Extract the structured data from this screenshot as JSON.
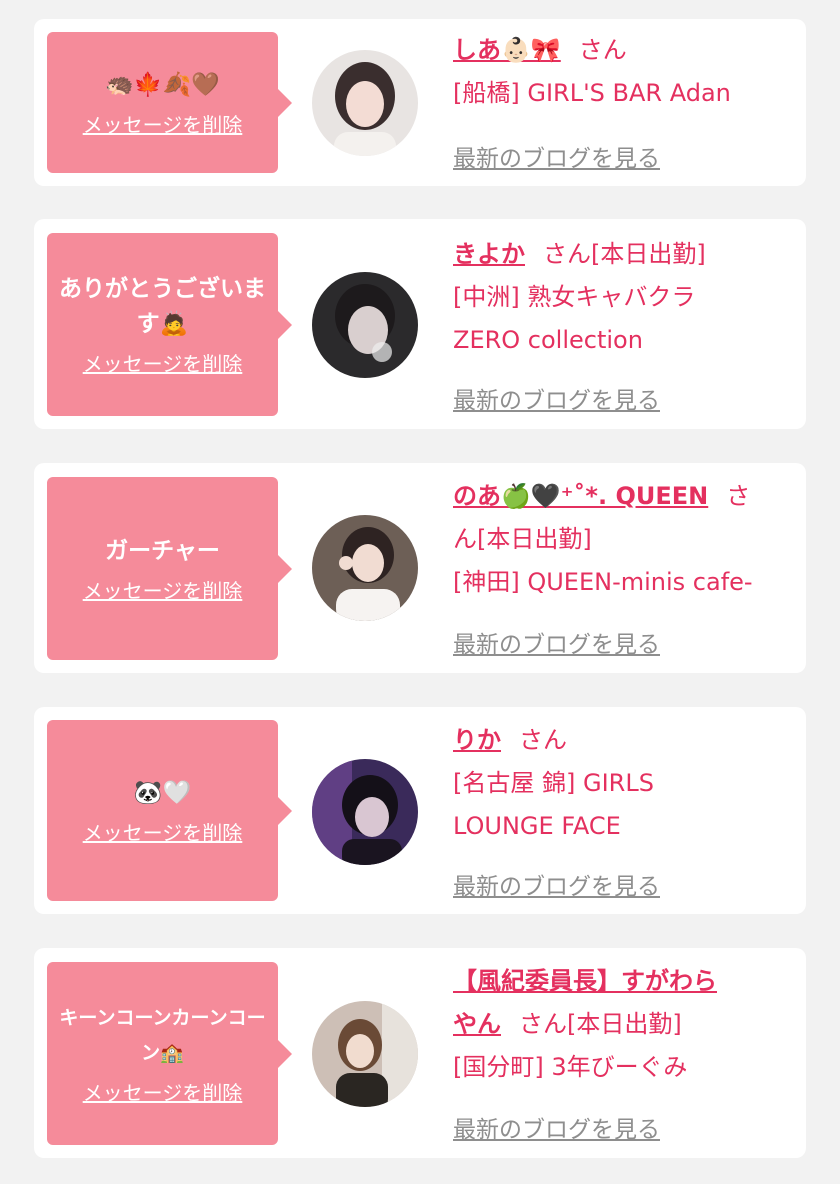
{
  "items": [
    {
      "message": "🦔🍁🍂🤎",
      "delete_label": "メッセージを削除",
      "name": "しあ👶🏻🎀",
      "honorific": "さん",
      "status": "",
      "shop_line1": "[船橋] GIRL'S BAR Adan",
      "shop_line2": "",
      "blog_label": "最新のブログを見る"
    },
    {
      "message": "ありがとうございます🙇",
      "delete_label": "メッセージを削除",
      "name": "きよか",
      "honorific": "さん",
      "status": "[本日出勤]",
      "shop_line1": "[中洲] 熟女キャバクラ",
      "shop_line2": "ZERO collection",
      "blog_label": "最新のブログを見る"
    },
    {
      "message": "ガーチャー",
      "delete_label": "メッセージを削除",
      "name": "のあ🍏🖤⁺˚*. QUEEN",
      "honorific": "さ",
      "name_wrap": "ん",
      "status": "[本日出勤]",
      "shop_line1": "[神田] QUEEN-minis cafe-",
      "shop_line2": "",
      "blog_label": "最新のブログを見る"
    },
    {
      "message": "🐼🤍",
      "delete_label": "メッセージを削除",
      "name": "りか",
      "honorific": "さん",
      "status": "",
      "shop_line1": "[名古屋 錦] GIRLS",
      "shop_line2": "LOUNGE FACE",
      "blog_label": "最新のブログを見る"
    },
    {
      "message": "キーンコーンカーンコーン🏫",
      "delete_label": "メッセージを削除",
      "name": "【風紀委員長】すがわら",
      "name_wrap": "やん",
      "honorific": "さん",
      "status": "[本日出勤]",
      "shop_line1": "[国分町] 3年びーぐみ",
      "shop_line2": "",
      "blog_label": "最新のブログを見る"
    }
  ],
  "colors": {
    "background": "#f2f2f2",
    "card": "#ffffff",
    "bubble": "#f58b9a",
    "accent_text": "#e4305f",
    "muted_text": "#8e8e8e"
  }
}
